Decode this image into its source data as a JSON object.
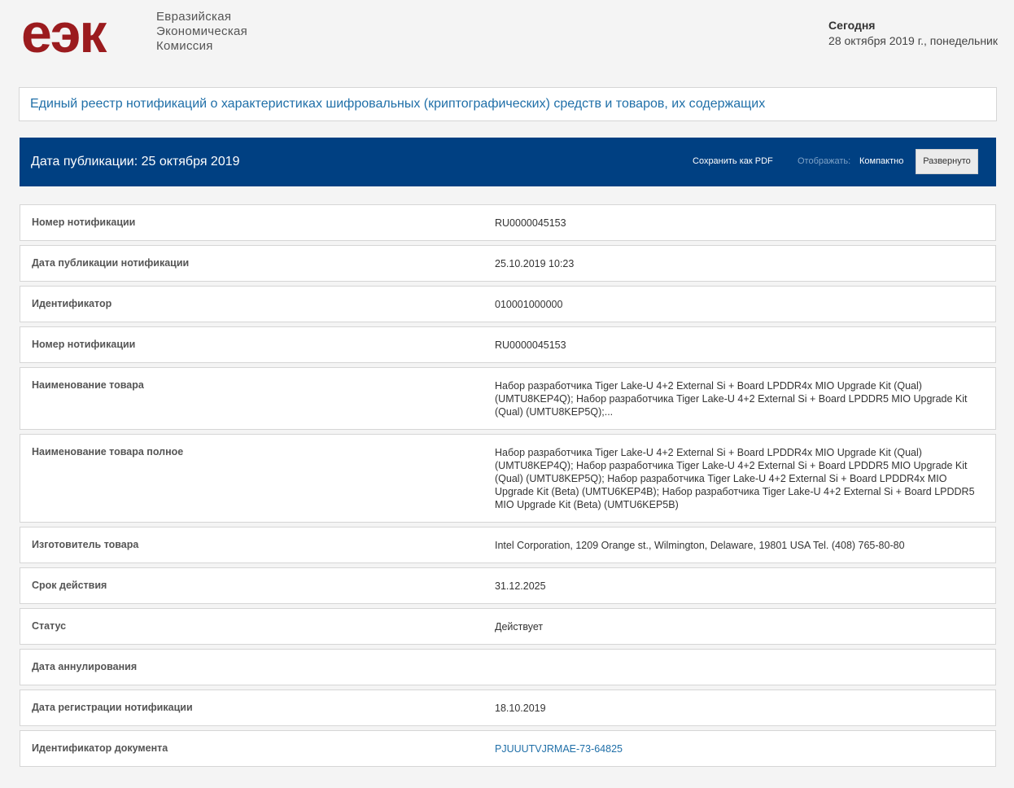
{
  "header": {
    "logo_mark": "еэк",
    "logo_lines": [
      "Евразийская",
      "Экономическая",
      "Комиссия"
    ],
    "today_label": "Сегодня",
    "today_date": "28 октября 2019 г., понедельник"
  },
  "title": "Единый реестр нотификаций о характеристиках шифровальных (криптографических) средств и товаров, их содержащих",
  "pub_bar": {
    "date_text": "Дата публикации: 25 октября 2019",
    "save_pdf": "Сохранить как PDF",
    "display_label": "Отображать:",
    "compact": "Компактно",
    "expanded": "Развернуто"
  },
  "rows": [
    {
      "label": "Номер нотификации",
      "value": "RU0000045153"
    },
    {
      "label": "Дата публикации нотификации",
      "value": "25.10.2019 10:23"
    },
    {
      "label": "Идентификатор",
      "value": "010001000000"
    },
    {
      "label": "Номер нотификации",
      "value": "RU0000045153"
    },
    {
      "label": "Наименование товара",
      "value": "Набор разработчика Tiger Lake-U 4+2 External Si + Board LPDDR4x MIO Upgrade Kit (Qual) (UMTU8KEP4Q); Набор разработчика Tiger Lake-U 4+2 External Si + Board LPDDR5 MIO Upgrade Kit (Qual) (UMTU8KEP5Q);..."
    },
    {
      "label": "Наименование товара полное",
      "value": "Набор разработчика Tiger Lake-U 4+2 External Si + Board LPDDR4x MIO Upgrade Kit (Qual) (UMTU8KEP4Q); Набор разработчика Tiger Lake-U 4+2 External Si + Board LPDDR5 MIO Upgrade Kit (Qual) (UMTU8KEP5Q); Набор разработчика Tiger Lake-U 4+2 External Si + Board LPDDR4x MIO Upgrade Kit (Beta) (UMTU6KEP4B); Набор разработчика Tiger Lake-U 4+2 External Si + Board LPDDR5 MIO Upgrade Kit (Beta) (UMTU6KEP5B)"
    },
    {
      "label": "Изготовитель товара",
      "value": "Intel Corporation, 1209 Orange st., Wilmington, Delaware, 19801 USA Tel. (408) 765-80-80"
    },
    {
      "label": "Срок действия",
      "value": "31.12.2025"
    },
    {
      "label": "Статус",
      "value": "Действует"
    },
    {
      "label": "Дата аннулирования",
      "value": ""
    },
    {
      "label": "Дата регистрации нотификации",
      "value": "18.10.2019"
    },
    {
      "label": "Идентификатор документа",
      "value": "PJUUUTVJRMAE-73-64825"
    }
  ],
  "colors": {
    "brand_red": "#9b1b1e",
    "bar_blue": "#004082",
    "link_blue": "#1f6fa8"
  }
}
